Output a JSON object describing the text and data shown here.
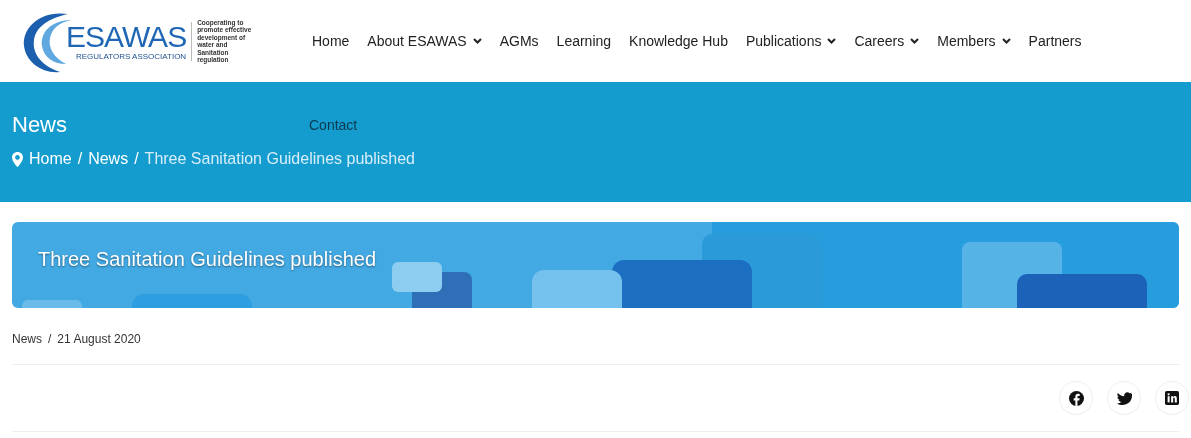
{
  "logo": {
    "name": "ESAWAS",
    "subtitle": "REGULATORS ASSOCIATION",
    "tagline": "Cooperating to promote effective development of water and Sanitation regulation"
  },
  "nav": [
    {
      "label": "Home",
      "dropdown": false
    },
    {
      "label": "About ESAWAS",
      "dropdown": true
    },
    {
      "label": "AGMs",
      "dropdown": false
    },
    {
      "label": "Learning",
      "dropdown": false
    },
    {
      "label": "Knowledge Hub",
      "dropdown": false
    },
    {
      "label": "Publications",
      "dropdown": true
    },
    {
      "label": "Careers",
      "dropdown": true
    },
    {
      "label": "Members",
      "dropdown": true
    },
    {
      "label": "Partners",
      "dropdown": false
    }
  ],
  "page_header": {
    "title": "News",
    "extra_link": "Contact",
    "breadcrumb": [
      "Home",
      "News",
      "Three Sanitation Guidelines published"
    ],
    "separator": "/"
  },
  "banner": {
    "title": "Three Sanitation Guidelines published",
    "kind": "picture"
  },
  "meta": {
    "category": "News",
    "separator": "/",
    "date": "21 August 2020"
  }
}
